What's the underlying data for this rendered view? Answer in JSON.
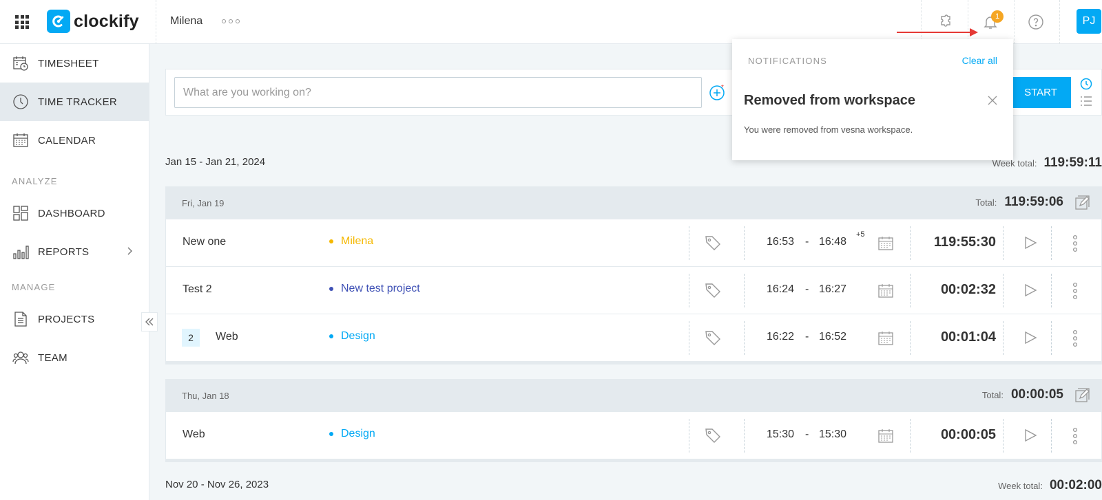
{
  "topbar": {
    "logo_text": "clockify",
    "workspace_name": "Milena",
    "notification_count": "1",
    "avatar_initials": "PJ"
  },
  "sidebar": {
    "items": [
      {
        "label": "TIMESHEET",
        "icon": "timesheet-icon"
      },
      {
        "label": "TIME TRACKER",
        "icon": "clock-icon",
        "active": true
      },
      {
        "label": "CALENDAR",
        "icon": "calendar-icon"
      }
    ],
    "analyze_label": "ANALYZE",
    "analyze_items": [
      {
        "label": "DASHBOARD",
        "icon": "dashboard-icon"
      },
      {
        "label": "REPORTS",
        "icon": "reports-icon"
      }
    ],
    "manage_label": "MANAGE",
    "manage_items": [
      {
        "label": "PROJECTS",
        "icon": "projects-icon"
      },
      {
        "label": "TEAM",
        "icon": "team-icon"
      }
    ]
  },
  "timer": {
    "placeholder": "What are you working on?",
    "start_label": "START"
  },
  "weeks": [
    {
      "range": "Jan 15 - Jan 21, 2024",
      "total_label": "Week total:",
      "total": "119:59:11",
      "days": [
        {
          "date": "Fri, Jan 19",
          "total_label": "Total:",
          "total": "119:59:06",
          "entries": [
            {
              "description": "New one",
              "project": "Milena",
              "project_color": "#f5b800",
              "start": "16:53",
              "end": "16:48",
              "plus": "+5",
              "duration": "119:55:30"
            },
            {
              "description": "Test 2",
              "project": "New test project",
              "project_color": "#3f51b5",
              "start": "16:24",
              "end": "16:27",
              "duration": "00:02:32"
            },
            {
              "group_count": "2",
              "description": "Web",
              "project": "Design",
              "project_color": "#03a9f4",
              "start": "16:22",
              "end": "16:52",
              "duration": "00:01:04"
            }
          ]
        },
        {
          "date": "Thu, Jan 18",
          "total_label": "Total:",
          "total": "00:00:05",
          "entries": [
            {
              "description": "Web",
              "project": "Design",
              "project_color": "#03a9f4",
              "start": "15:30",
              "end": "15:30",
              "duration": "00:00:05"
            }
          ]
        }
      ]
    },
    {
      "range": "Nov 20 - Nov 26, 2023",
      "total_label": "Week total:",
      "total": "00:02:00"
    }
  ],
  "notifications": {
    "header": "NOTIFICATIONS",
    "clear_all": "Clear all",
    "title": "Removed from workspace",
    "body": "You were removed from vesna workspace."
  },
  "colors": {
    "accent": "#03a9f4",
    "badge": "#f5a623",
    "annotation_arrow": "#e53935"
  }
}
